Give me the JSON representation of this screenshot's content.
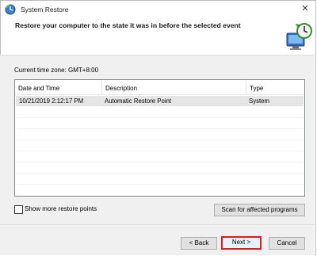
{
  "window": {
    "title": "System Restore",
    "close_glyph": "✕"
  },
  "header": {
    "heading": "Restore your computer to the state it was in before the selected event"
  },
  "timezone": {
    "label": "Current time zone: GMT+8:00"
  },
  "table": {
    "columns": [
      "Date and Time",
      "Description",
      "Type"
    ],
    "sort_glyph": "⌄",
    "rows": [
      {
        "date_time": "10/21/2019 2:12:17 PM",
        "description": "Automatic Restore Point",
        "type": "System"
      }
    ]
  },
  "options": {
    "show_more_label": "Show more restore points",
    "show_more_checked": false,
    "scan_button": "Scan for affected programs"
  },
  "footer": {
    "back_button": "< Back",
    "next_button": "Next >",
    "cancel_button": "Cancel"
  },
  "colors": {
    "accent": "#0078d7",
    "highlight": "#e01b1b"
  },
  "icons": {
    "app": "system-restore-icon",
    "header": "restore-monitor-clock-icon"
  }
}
